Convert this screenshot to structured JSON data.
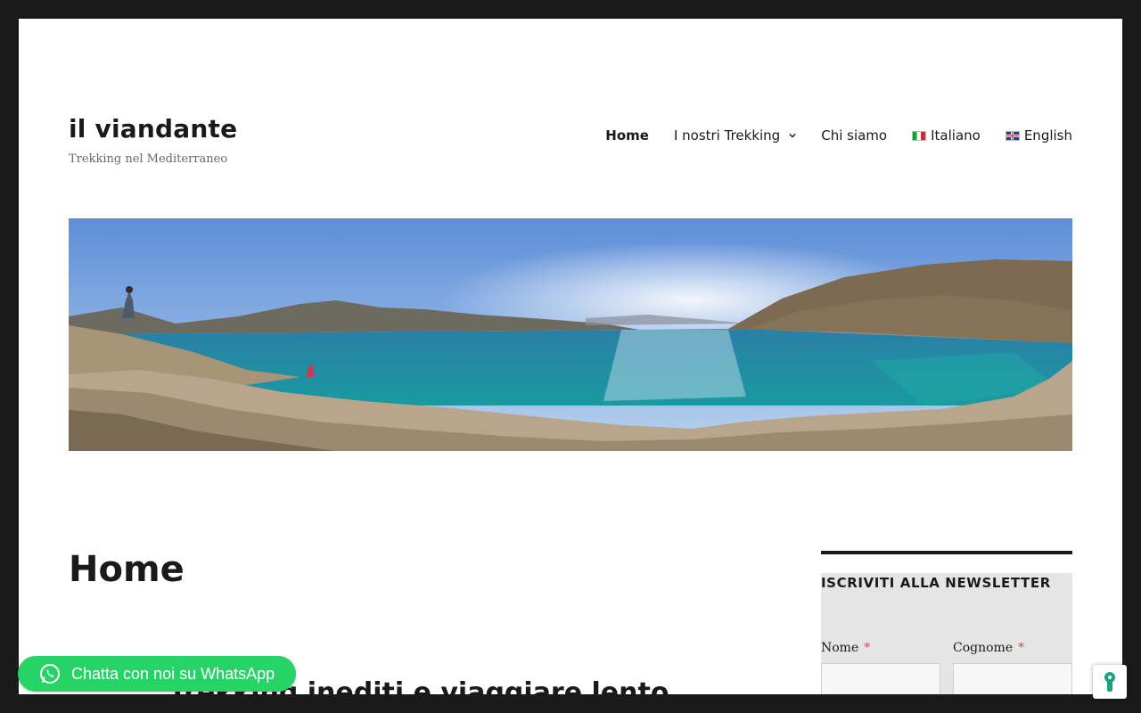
{
  "site": {
    "title": "il viandante",
    "tagline": "Trekking nel Mediterraneo"
  },
  "nav": {
    "items": [
      {
        "label": "Home",
        "active": true
      },
      {
        "label": "I nostri Trekking",
        "has_dropdown": true
      },
      {
        "label": "Chi siamo"
      },
      {
        "label": "Italiano",
        "flag": "it-flag-icon"
      },
      {
        "label": "English",
        "flag": "gb-flag-icon"
      }
    ]
  },
  "hero": {
    "image": "panoramic coastal bay with hikers",
    "colors": {
      "sky": "#6d97d9",
      "sea": "#1e8aa8",
      "shore": "#bfa98f"
    }
  },
  "main": {
    "title": "Home",
    "post_heading": "Trekking inediti e viaggiare lento"
  },
  "sidebar": {
    "widget_title": "ISCRIVITI ALLA NEWSLETTER",
    "fields": [
      {
        "label": "Nome",
        "required_mark": "*"
      },
      {
        "label": "Cognome",
        "required_mark": "*"
      }
    ]
  },
  "whatsapp": {
    "label": "Chatta con noi su WhatsApp",
    "icon": "whatsapp-icon",
    "color": "#25d366"
  },
  "cookie": {
    "icon": "keyhole-icon",
    "color": "#1aa383"
  }
}
